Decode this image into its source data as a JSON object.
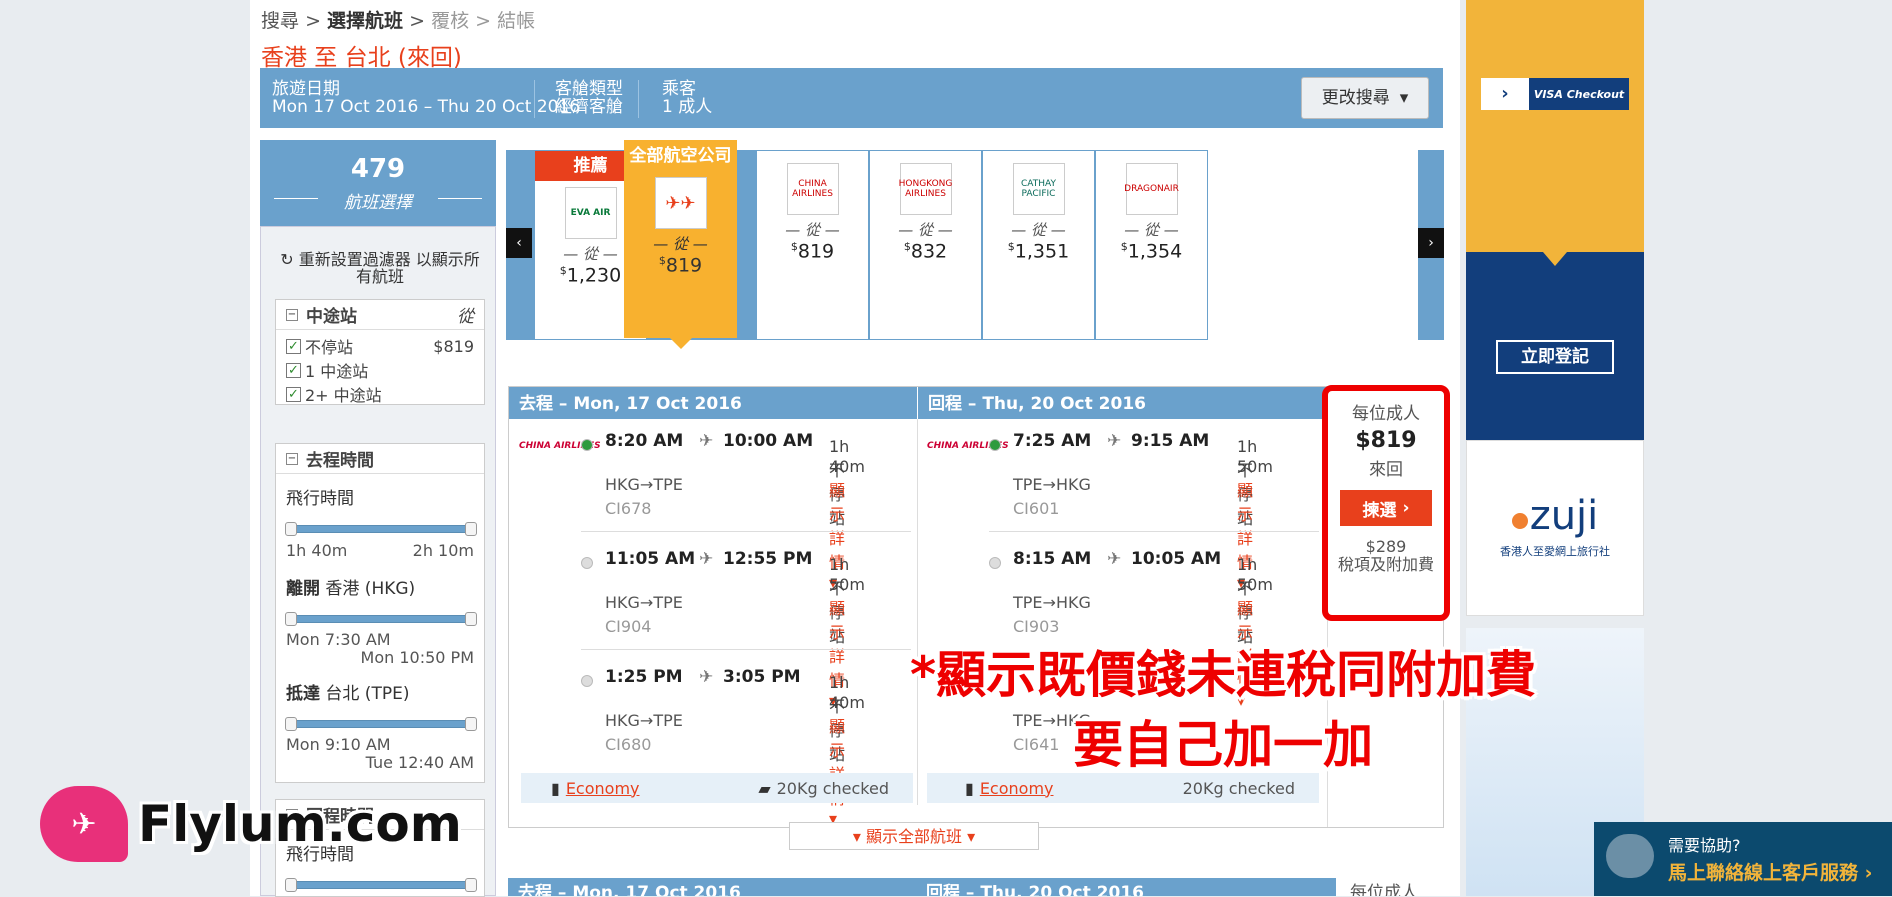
{
  "breadcrumb": {
    "step1": "搜尋",
    "sep": ">",
    "step2": "選擇航班",
    "step3": "覆核",
    "step4": "結帳"
  },
  "route_title": "香港 至 台北 (來回)",
  "summary": {
    "date_label": "旅遊日期",
    "date_value": "Mon 17 Oct 2016 – Thu 20 Oct 2016",
    "cabin_label": "客艙類型",
    "cabin_value": "經濟客艙",
    "pax_label": "乘客",
    "pax_value": "1 成人",
    "modify_label": "更改搜尋"
  },
  "sidebar": {
    "count": "479",
    "count_label": "航班選擇",
    "reset": "重新設置過濾器 以顯示所有航班",
    "stops": {
      "title": "中途站",
      "from": "從",
      "opt1": "不停站",
      "opt1_price": "$819",
      "opt2": "1 中途站",
      "opt3": "2+ 中途站"
    },
    "outbound": {
      "title": "去程時間",
      "duration_label": "飛行時間",
      "dur_min": "1h 40m",
      "dur_max": "2h 10m",
      "depart_label": "離開",
      "depart_place": "香港 (HKG)",
      "dep_min": "Mon 7:30 AM",
      "dep_max": "Mon 10:50 PM",
      "arrive_label": "抵達",
      "arrive_place": "台北 (TPE)",
      "arr_min": "Mon 9:10 AM",
      "arr_max": "Tue 12:40 AM"
    },
    "return": {
      "title": "回程時間",
      "duration_label": "飛行時間"
    }
  },
  "carousel": {
    "from": "從",
    "cards": [
      {
        "tag": "推薦",
        "airline": "EVA AIR",
        "price": "1,230"
      },
      {
        "tag": "全部航空公司",
        "airline": "全部",
        "price": "819"
      },
      {
        "tag": "",
        "airline": "CHINA AIRLINES",
        "price": "819"
      },
      {
        "tag": "",
        "airline": "HONGKONG AIRLINES",
        "price": "832"
      },
      {
        "tag": "",
        "airline": "CATHAY PACIFIC",
        "price": "1,351"
      },
      {
        "tag": "",
        "airline": "DRAGONAIR",
        "price": "1,354"
      }
    ]
  },
  "results": {
    "out_header": "去程 – Mon, 17 Oct 2016",
    "ret_header": "回程 – Thu, 20 Oct 2016",
    "airline": "CHINA AIRLINES",
    "detail_label": "顯示詳情",
    "stop_label": "不停站",
    "out": [
      {
        "dep": "8:20 AM",
        "arr": "10:00 AM",
        "dur": "1h 40m",
        "path": "HKG→TPE",
        "num": "CI678"
      },
      {
        "dep": "11:05 AM",
        "arr": "12:55 PM",
        "dur": "1h 50m",
        "path": "HKG→TPE",
        "num": "CI904"
      },
      {
        "dep": "1:25 PM",
        "arr": "3:05 PM",
        "dur": "1h 40m",
        "path": "HKG→TPE",
        "num": "CI680"
      }
    ],
    "ret": [
      {
        "dep": "7:25 AM",
        "arr": "9:15 AM",
        "dur": "1h 50m",
        "path": "TPE→HKG",
        "num": "CI601"
      },
      {
        "dep": "8:15 AM",
        "arr": "10:05 AM",
        "dur": "1h 50m",
        "path": "TPE→HKG",
        "num": "CI903"
      },
      {
        "dep": "",
        "arr": "",
        "dur": "",
        "path": "TPE→HKG",
        "num": "CI641"
      }
    ],
    "cabin": "Economy",
    "baggage": "20Kg checked",
    "price": {
      "per": "每位成人",
      "amount": "$819",
      "trip": "來回",
      "pick": "揀選",
      "tax": "$289",
      "tax_label": "稅項及附加費"
    },
    "show_all": "顯示全部航班",
    "next_out": "去程 – Mon, 17 Oct 2016",
    "next_ret": "回程 – Thu, 20 Oct 2016",
    "next_per": "每位成人"
  },
  "ads": {
    "visa": "VISA Checkout",
    "register": "立即登記",
    "zuji": "zuji",
    "zuji_tag": "香港人至愛網上旅行社"
  },
  "help": {
    "line1": "需要協助?",
    "line2": "馬上聯絡線上客戶服務"
  },
  "annotation": {
    "line1": "*顯示既價錢未連稅同附加費",
    "line2": "要自己加一加"
  },
  "watermark": "Flylum.com",
  "colors": {
    "accent": "#6aa1cc",
    "orange": "#e8401c",
    "gold": "#f8b12f",
    "navy": "#123e7c"
  }
}
